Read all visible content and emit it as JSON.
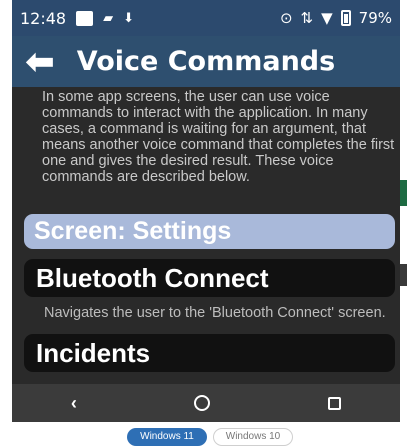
{
  "status_bar": {
    "time": "12:48",
    "battery": "79%"
  },
  "app_bar": {
    "title": "Voice Commands"
  },
  "intro_text": "In some app screens, the user can use voice commands to interact with the application. In many cases, a command is waiting for an argument, that means another voice command that completes the first one and gives the desired result. These voice commands are described below.",
  "section": {
    "label": "Screen: Settings"
  },
  "commands": [
    {
      "label": "Bluetooth Connect",
      "description": "Navigates the user to the 'Bluetooth Connect' screen."
    },
    {
      "label": "Incidents",
      "description": ""
    }
  ],
  "nav_bar": {
    "back_glyph": "‹",
    "home_icon": "circle-home-icon",
    "recents_icon": "square-recents-icon"
  },
  "os_tabs": [
    {
      "label": "Windows 11",
      "active": true
    },
    {
      "label": "Windows 10",
      "active": false
    }
  ],
  "colors": {
    "status_bar": "#2c4a6e",
    "app_bar": "#2e4f6f",
    "content_bg": "#2a2a2a",
    "section_header": "#a9b9da",
    "command_button": "#111111",
    "nav_bar": "#3b3b3b",
    "tab_active": "#2e6fb5"
  }
}
